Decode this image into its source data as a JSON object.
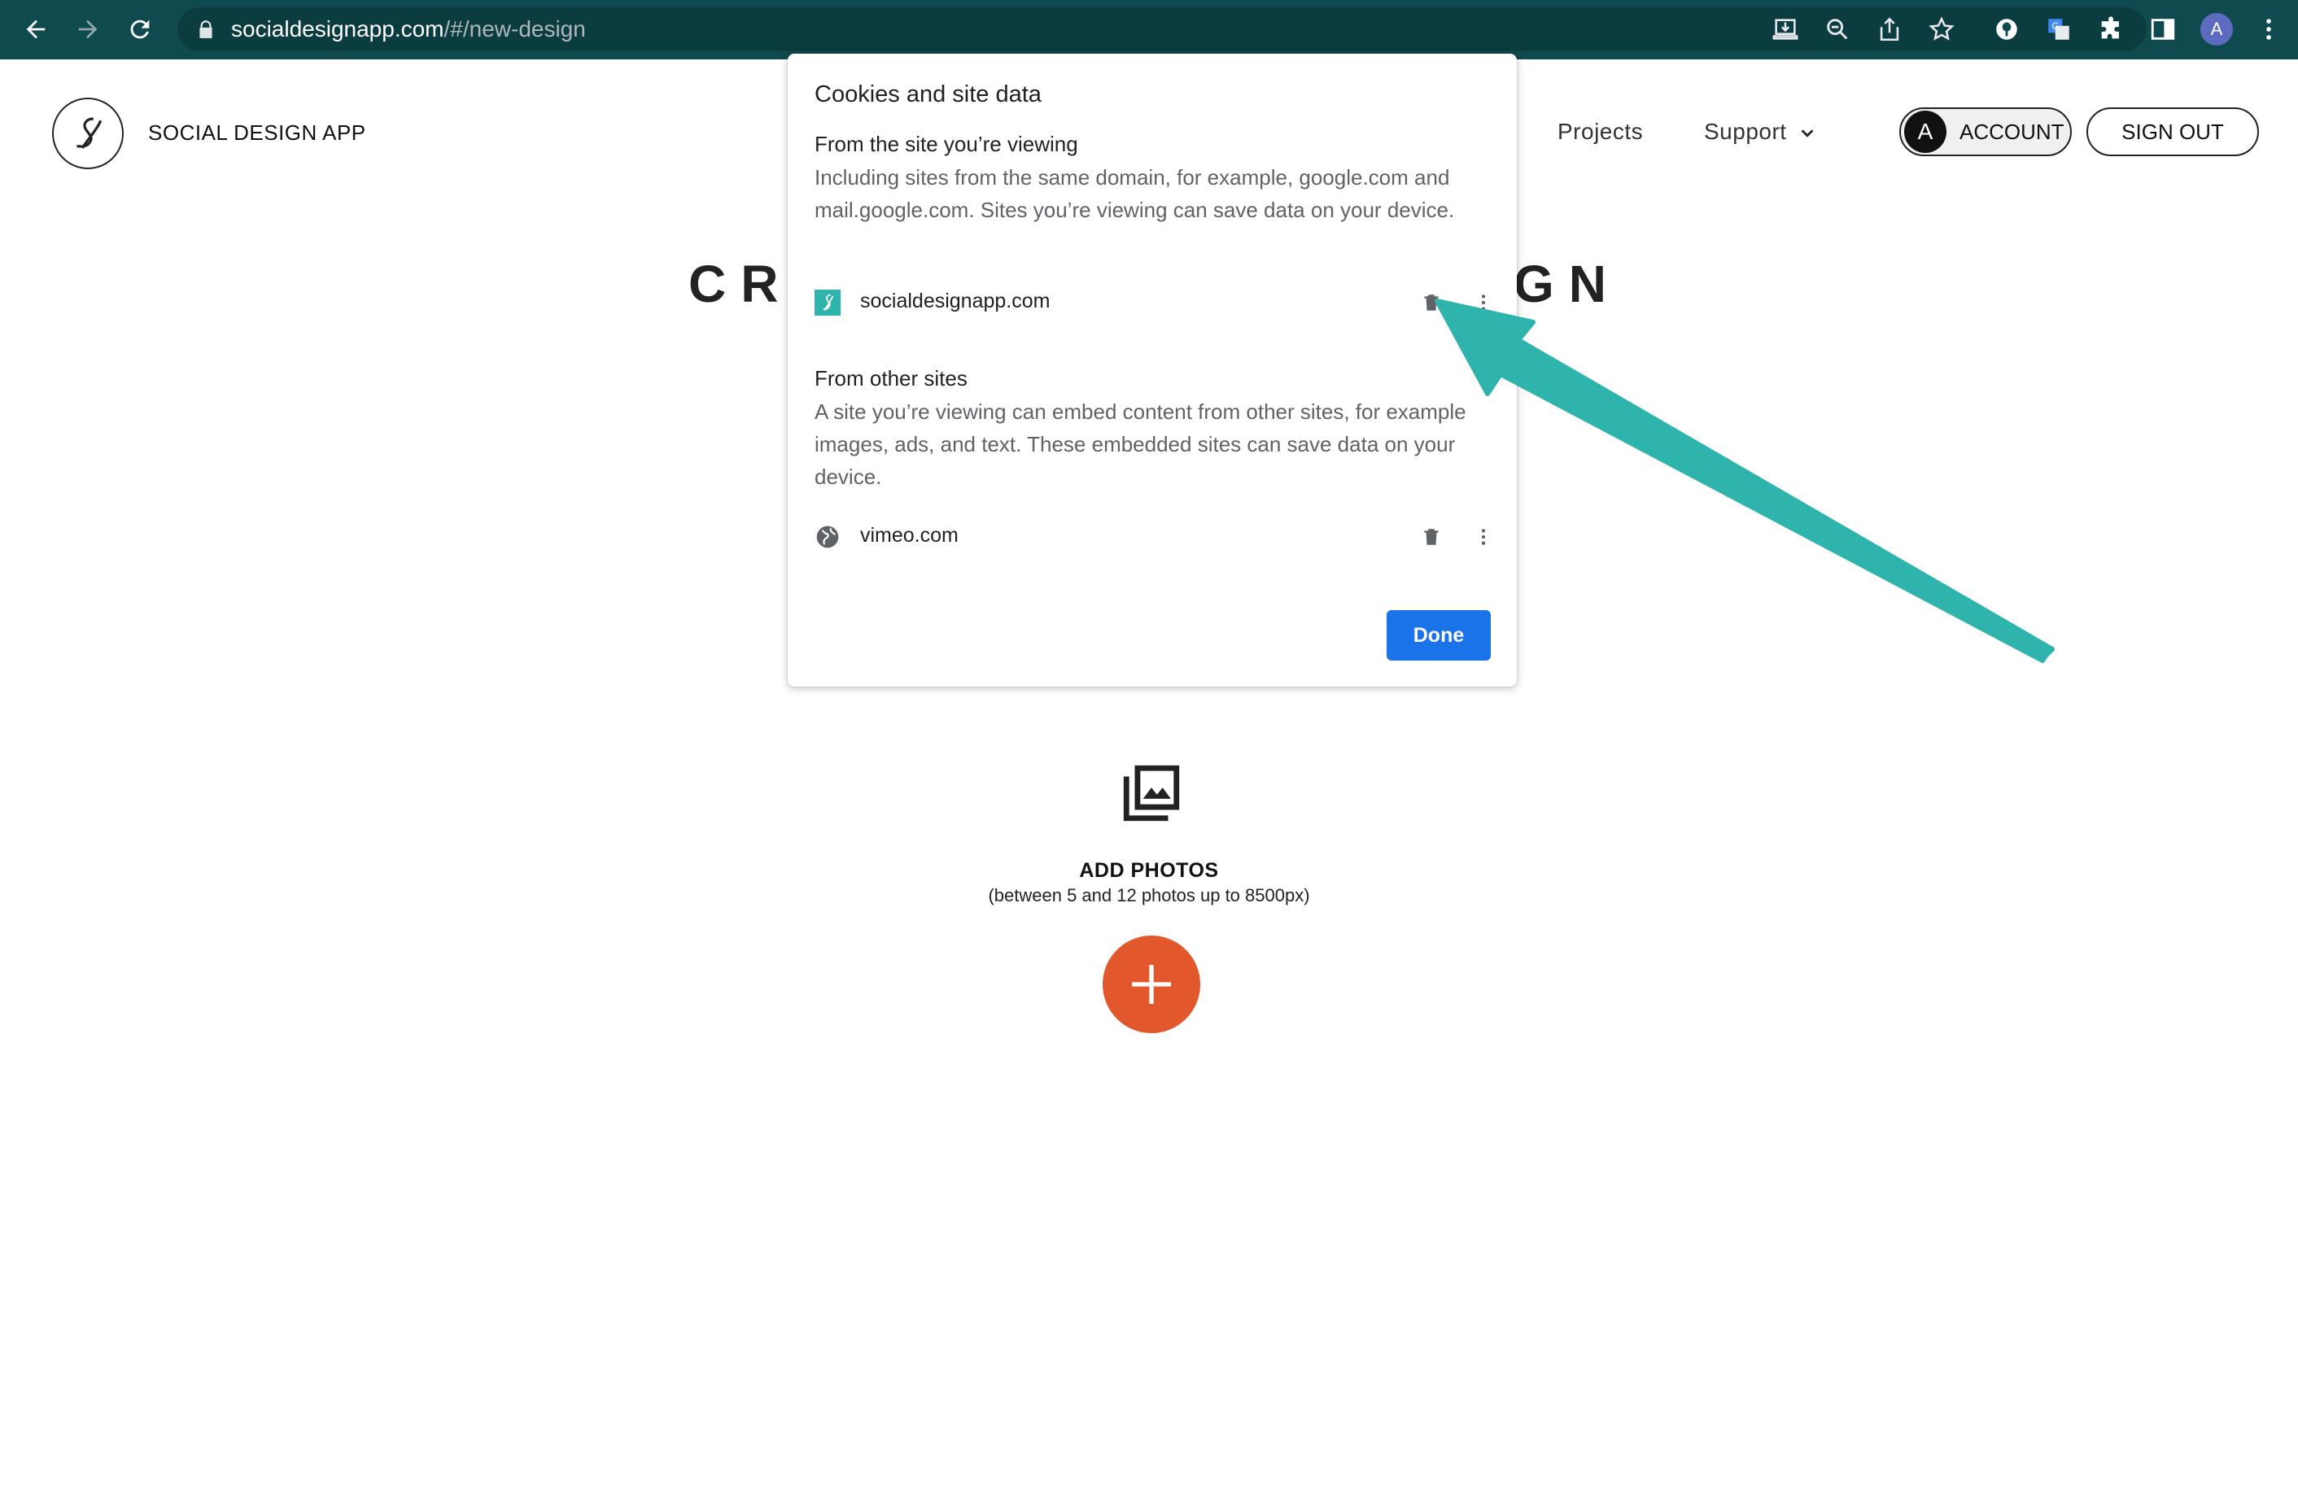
{
  "browser": {
    "url_host": "socialdesignapp.com",
    "url_path": "/#/new-design",
    "profile_initial": "A",
    "toolbar_icons": [
      "install-icon",
      "zoom-icon",
      "share-icon",
      "bookmark-star-icon",
      "password-manager-icon",
      "translate-icon",
      "extensions-icon",
      "side-panel-icon",
      "profile-avatar",
      "menu-kebab-icon"
    ]
  },
  "site": {
    "brand": "SOCIAL DESIGN APP",
    "nav": {
      "projects": "Projects",
      "support": "Support"
    },
    "account_initial": "A",
    "account_label": "ACCOUNT",
    "signout_label": "SIGN OUT",
    "page_title_left": "CR",
    "page_title_right": "GN",
    "add_photos_title": "ADD PHOTOS",
    "add_photos_subtitle": "(between 5 and 12 photos up to 8500px)"
  },
  "popup": {
    "title": "Cookies and site data",
    "section1": {
      "title": "From the site you’re viewing",
      "desc": "Including sites from the same domain, for example, google.com and mail.google.com. Sites you’re viewing can save data on your device.",
      "site": "socialdesignapp.com"
    },
    "section2": {
      "title": "From other sites",
      "desc": "A site you’re viewing can embed content from other sites, for example images, ads, and text. These embedded sites can save data on your device.",
      "site": "vimeo.com"
    },
    "done_label": "Done"
  },
  "colors": {
    "chrome_bg": "#0f4a4f",
    "done_blue": "#1a73e8",
    "add_orange": "#e2572b",
    "arrow_teal": "#2eb3ad"
  }
}
